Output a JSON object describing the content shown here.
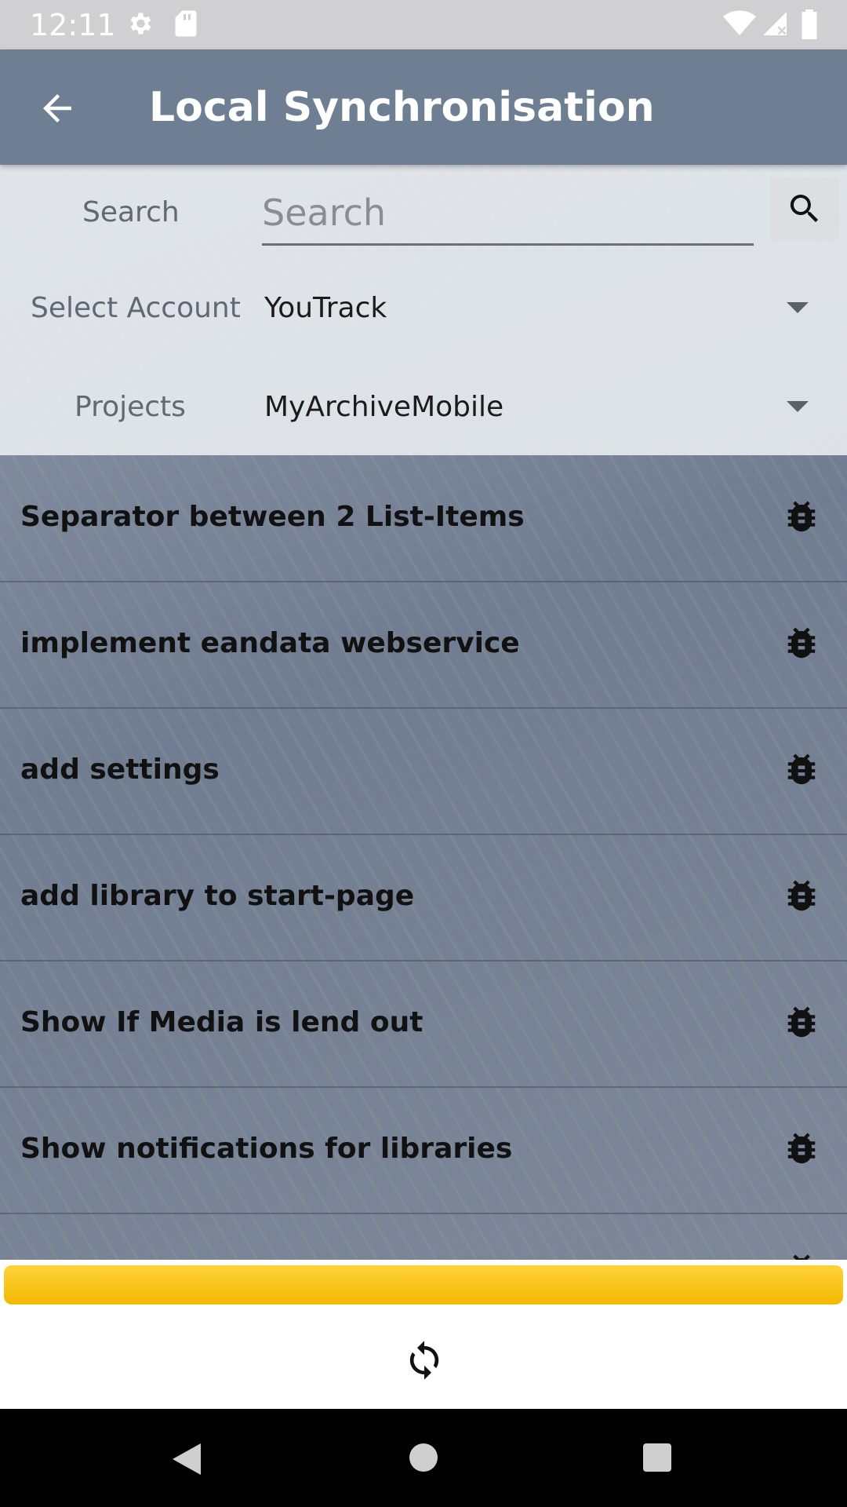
{
  "status_bar": {
    "time": "12:11",
    "icons": [
      "settings-icon",
      "sd-card-icon",
      "wifi-icon",
      "signal-icon",
      "battery-icon"
    ]
  },
  "app_bar": {
    "title": "Local Synchronisation",
    "back_icon": "arrow-back-icon",
    "color": "#6e7f94"
  },
  "filters": {
    "search": {
      "label": "Search",
      "placeholder": "Search",
      "value": "",
      "button_icon": "search-icon"
    },
    "account": {
      "label": "Select Account",
      "selected": "YouTrack"
    },
    "projects": {
      "label": "Projects",
      "selected": "MyArchiveMobile"
    }
  },
  "issues": [
    {
      "title": "Separator between 2 List-Items",
      "icon": "bug-icon"
    },
    {
      "title": "implement eandata webservice",
      "icon": "bug-icon"
    },
    {
      "title": "add settings",
      "icon": "bug-icon"
    },
    {
      "title": "add library to start-page",
      "icon": "bug-icon"
    },
    {
      "title": "Show If Media is lend out",
      "icon": "bug-icon"
    },
    {
      "title": "Show notifications for libraries",
      "icon": "bug-icon"
    }
  ],
  "progress": {
    "fraction": 1.0,
    "color": "#f9c300"
  },
  "actions": {
    "sync_icon": "sync-icon"
  },
  "nav_bar": {
    "icons": [
      "back-triangle-icon",
      "home-circle-icon",
      "recents-square-icon"
    ]
  }
}
